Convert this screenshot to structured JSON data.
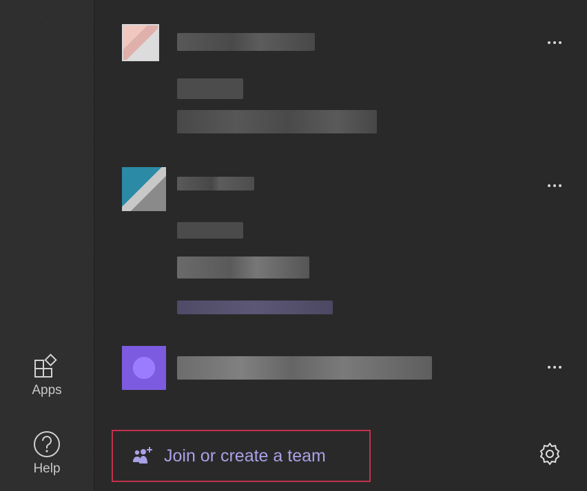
{
  "rail": {
    "apps": {
      "label": "Apps",
      "icon": "apps-icon"
    },
    "help": {
      "label": "Help",
      "icon": "help-icon"
    }
  },
  "teams": [
    {
      "name": "",
      "more_icon": "more-options-icon"
    },
    {
      "name": "",
      "more_icon": "more-options-icon"
    },
    {
      "name": "",
      "more_icon": "more-options-icon"
    }
  ],
  "footer": {
    "join_label": "Join or create a team",
    "join_icon": "join-team-icon",
    "settings_icon": "gear-icon"
  },
  "colors": {
    "accent": "#a9a1e6",
    "focus_border": "#c4314b",
    "background": "#292929",
    "rail": "#2e2e2e"
  }
}
